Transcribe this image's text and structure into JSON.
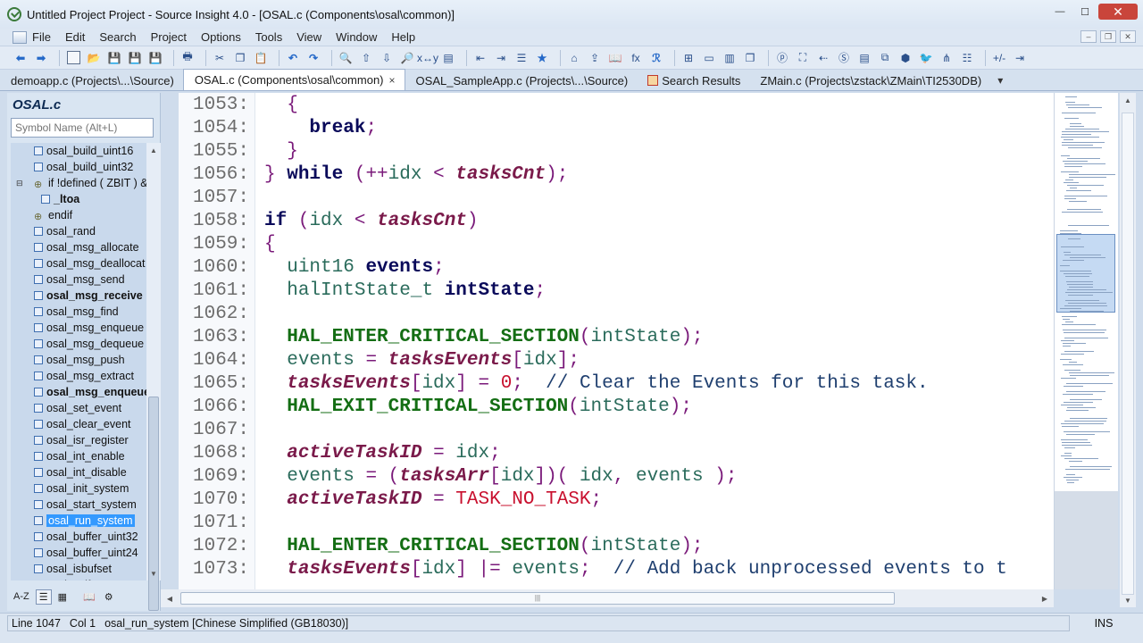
{
  "window": {
    "title": "Untitled Project Project - Source Insight 4.0 - [OSAL.c (Components\\osal\\common)]",
    "minimize": "—",
    "maximize": "☐",
    "close": "✕"
  },
  "menu": [
    "File",
    "Edit",
    "Search",
    "Project",
    "Options",
    "Tools",
    "View",
    "Window",
    "Help"
  ],
  "tabs": [
    {
      "label": "demoapp.c (Projects\\...\\Source)",
      "active": false
    },
    {
      "label": "OSAL.c (Components\\osal\\common)",
      "active": true,
      "close": "×"
    },
    {
      "label": "OSAL_SampleApp.c (Projects\\...\\Source)",
      "active": false
    },
    {
      "label": "Search Results",
      "active": false
    },
    {
      "label": "ZMain.c (Projects\\zstack\\ZMain\\TI2530DB)",
      "active": false
    }
  ],
  "tab_more": "▾",
  "left_panel": {
    "title": "OSAL.c",
    "search_placeholder": "Symbol Name (Alt+L)",
    "symbols": [
      "osal_build_uint16",
      "osal_build_uint32",
      "if !defined ( ZBIT ) &",
      "_ltoa",
      "endif",
      "osal_rand",
      "osal_msg_allocate",
      "osal_msg_deallocat",
      "osal_msg_send",
      "osal_msg_receive",
      "osal_msg_find",
      "osal_msg_enqueue",
      "osal_msg_dequeue",
      "osal_msg_push",
      "osal_msg_extract",
      "osal_msg_enqueue",
      "osal_set_event",
      "osal_clear_event",
      "osal_isr_register",
      "osal_int_enable",
      "osal_int_disable",
      "osal_init_system",
      "osal_start_system",
      "osal_run_system",
      "osal_buffer_uint32",
      "osal_buffer_uint24",
      "osal_isbufset",
      "osal_self"
    ],
    "bottom_buttons": [
      "A-Z",
      "☰",
      "▦",
      "⚙"
    ]
  },
  "editor": {
    "lines": [
      {
        "n": "1053:",
        "html": "  <span class='punc'>{</span>"
      },
      {
        "n": "1054:",
        "html": "    <span class='kw'>break</span><span class='punc'>;</span>"
      },
      {
        "n": "1055:",
        "html": "  <span class='punc'>}</span>"
      },
      {
        "n": "1056:",
        "html": "<span class='punc'>}</span> <span class='kw'>while</span> <span class='punc'>(++</span><span class='var'>idx</span> <span class='punc'>&lt;</span> <span class='glob'>tasksCnt</span><span class='punc'>);</span>"
      },
      {
        "n": "1057:",
        "html": ""
      },
      {
        "n": "1058:",
        "html": "<span class='kw'>if</span> <span class='punc'>(</span><span class='var'>idx</span> <span class='punc'>&lt;</span> <span class='glob'>tasksCnt</span><span class='punc'>)</span>"
      },
      {
        "n": "1059:",
        "html": "<span class='punc'>{</span>"
      },
      {
        "n": "1060:",
        "html": "  <span class='typ'>uint16</span> <span class='kw'>events</span><span class='punc'>;</span>"
      },
      {
        "n": "1061:",
        "html": "  <span class='typ'>halIntState_t</span> <span class='kw'>intState</span><span class='punc'>;</span>"
      },
      {
        "n": "1062:",
        "html": ""
      },
      {
        "n": "1063:",
        "html": "  <span class='mac'>HAL_ENTER_CRITICAL_SECTION</span><span class='punc'>(</span><span class='var'>intState</span><span class='punc'>);</span>"
      },
      {
        "n": "1064:",
        "html": "  <span class='var'>events</span> <span class='punc'>=</span> <span class='glob'>tasksEvents</span><span class='punc'>[</span><span class='var'>idx</span><span class='punc'>];</span>"
      },
      {
        "n": "1065:",
        "html": "  <span class='glob'>tasksEvents</span><span class='punc'>[</span><span class='var'>idx</span><span class='punc'>]</span> <span class='punc'>=</span> <span class='num'>0</span><span class='punc'>;</span>  <span class='cmt'>// Clear the Events for this task.</span>"
      },
      {
        "n": "1066:",
        "html": "  <span class='mac'>HAL_EXIT_CRITICAL_SECTION</span><span class='punc'>(</span><span class='var'>intState</span><span class='punc'>);</span>"
      },
      {
        "n": "1067:",
        "html": ""
      },
      {
        "n": "1068:",
        "html": "  <span class='glob'>activeTaskID</span> <span class='punc'>=</span> <span class='var'>idx</span><span class='punc'>;</span>"
      },
      {
        "n": "1069:",
        "html": "  <span class='var'>events</span> <span class='punc'>=</span> <span class='punc'>(</span><span class='glob'>tasksArr</span><span class='punc'>[</span><span class='var'>idx</span><span class='punc'>])(</span> <span class='var'>idx</span><span class='punc'>,</span> <span class='var'>events</span> <span class='punc'>);</span>"
      },
      {
        "n": "1070:",
        "html": "  <span class='glob'>activeTaskID</span> <span class='punc'>=</span> <span class='const'>TASK_NO_TASK</span><span class='punc'>;</span>"
      },
      {
        "n": "1071:",
        "html": ""
      },
      {
        "n": "1072:",
        "html": "  <span class='mac'>HAL_ENTER_CRITICAL_SECTION</span><span class='punc'>(</span><span class='var'>intState</span><span class='punc'>);</span>"
      },
      {
        "n": "1073:",
        "html": "  <span class='glob'>tasksEvents</span><span class='punc'>[</span><span class='var'>idx</span><span class='punc'>]</span> <span class='punc'>|=</span> <span class='var'>events</span><span class='punc'>;</span>  <span class='cmt'>// Add back unprocessed events to t</span>"
      }
    ]
  },
  "status": {
    "line": "Line 1047",
    "col": "Col 1",
    "context": "osal_run_system [Chinese Simplified (GB18030)]",
    "mode": "INS"
  }
}
